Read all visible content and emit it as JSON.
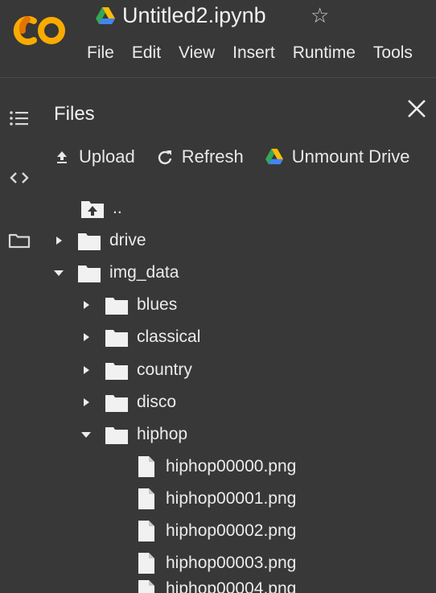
{
  "header": {
    "notebook_title": "Untitled2.ipynb",
    "menu": [
      "File",
      "Edit",
      "View",
      "Insert",
      "Runtime",
      "Tools"
    ]
  },
  "files_panel": {
    "title": "Files",
    "actions": {
      "upload": "Upload",
      "refresh": "Refresh",
      "unmount": "Unmount Drive"
    },
    "tree": {
      "parent": "..",
      "drive": "drive",
      "img_data": "img_data",
      "blues": "blues",
      "classical": "classical",
      "country": "country",
      "disco": "disco",
      "hiphop": "hiphop",
      "files": [
        "hiphop00000.png",
        "hiphop00001.png",
        "hiphop00002.png",
        "hiphop00003.png",
        "hiphop00004.png"
      ]
    }
  },
  "colors": {
    "background": "#383838",
    "logo_orange": "#f9ab00",
    "logo_orange_dark": "#e37400",
    "text": "#ececec"
  }
}
